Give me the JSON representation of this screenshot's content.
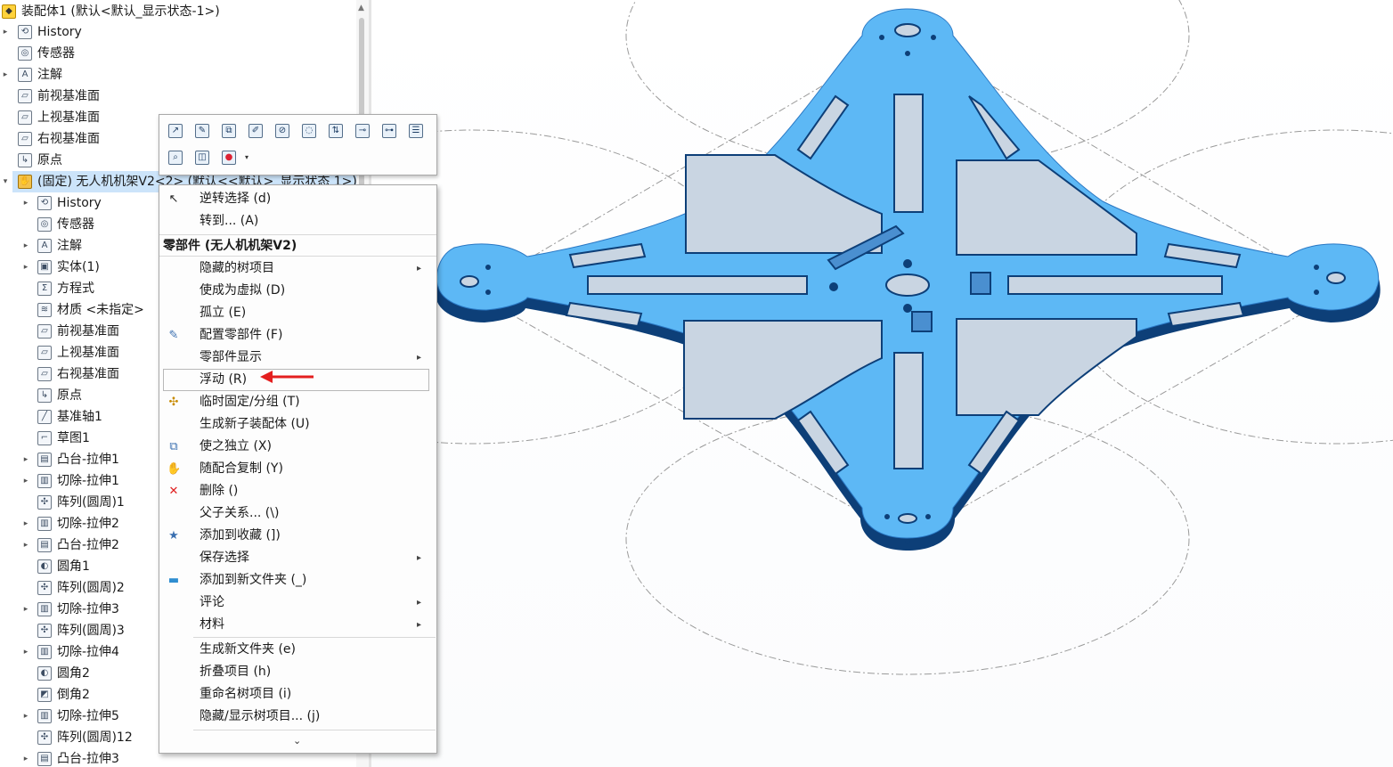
{
  "feature_tree": {
    "items": [
      {
        "label": "装配体1 (默认<默认_显示状态-1>)",
        "icon": "assembly-icon",
        "expander": "",
        "indent": 0
      },
      {
        "label": "History",
        "icon": "history-icon",
        "expander": "▸",
        "indent": 1
      },
      {
        "label": "传感器",
        "icon": "sensor-icon",
        "expander": "",
        "indent": 1
      },
      {
        "label": "注解",
        "icon": "annotation-icon",
        "expander": "▸",
        "indent": 1
      },
      {
        "label": "前视基准面",
        "icon": "plane-icon",
        "expander": "",
        "indent": 1
      },
      {
        "label": "上视基准面",
        "icon": "plane-icon",
        "expander": "",
        "indent": 1
      },
      {
        "label": "右视基准面",
        "icon": "plane-icon",
        "expander": "",
        "indent": 1
      },
      {
        "label": "原点",
        "icon": "origin-icon",
        "expander": "",
        "indent": 1
      },
      {
        "label": "(固定) 无人机机架V2<2> (默认<<默认>_显示状态 1>)",
        "icon": "part-icon",
        "expander": "▾",
        "indent": 1,
        "selected": true
      },
      {
        "label": "History",
        "icon": "history-icon",
        "expander": "▸",
        "indent": 2
      },
      {
        "label": "传感器",
        "icon": "sensor-icon",
        "expander": "",
        "indent": 2
      },
      {
        "label": "注解",
        "icon": "annotation-icon",
        "expander": "▸",
        "indent": 2
      },
      {
        "label": "实体(1)",
        "icon": "solid-bodies-icon",
        "expander": "▸",
        "indent": 2
      },
      {
        "label": "方程式",
        "icon": "equations-icon",
        "expander": "",
        "indent": 2
      },
      {
        "label": "材质 <未指定>",
        "icon": "material-icon",
        "expander": "",
        "indent": 2
      },
      {
        "label": "前视基准面",
        "icon": "plane-icon",
        "expander": "",
        "indent": 2
      },
      {
        "label": "上视基准面",
        "icon": "plane-icon",
        "expander": "",
        "indent": 2
      },
      {
        "label": "右视基准面",
        "icon": "plane-icon",
        "expander": "",
        "indent": 2
      },
      {
        "label": "原点",
        "icon": "origin-icon",
        "expander": "",
        "indent": 2
      },
      {
        "label": "基准轴1",
        "icon": "axis-icon",
        "expander": "",
        "indent": 2
      },
      {
        "label": "草图1",
        "icon": "sketch-icon",
        "expander": "",
        "indent": 2
      },
      {
        "label": "凸台-拉伸1",
        "icon": "boss-extrude-icon",
        "expander": "▸",
        "indent": 2
      },
      {
        "label": "切除-拉伸1",
        "icon": "cut-extrude-icon",
        "expander": "▸",
        "indent": 2
      },
      {
        "label": "阵列(圆周)1",
        "icon": "circular-pattern-icon",
        "expander": "",
        "indent": 2
      },
      {
        "label": "切除-拉伸2",
        "icon": "cut-extrude-icon",
        "expander": "▸",
        "indent": 2
      },
      {
        "label": "凸台-拉伸2",
        "icon": "boss-extrude-icon",
        "expander": "▸",
        "indent": 2
      },
      {
        "label": "圆角1",
        "icon": "fillet-icon",
        "expander": "",
        "indent": 2
      },
      {
        "label": "阵列(圆周)2",
        "icon": "circular-pattern-icon",
        "expander": "",
        "indent": 2
      },
      {
        "label": "切除-拉伸3",
        "icon": "cut-extrude-icon",
        "expander": "▸",
        "indent": 2
      },
      {
        "label": "阵列(圆周)3",
        "icon": "circular-pattern-icon",
        "expander": "",
        "indent": 2
      },
      {
        "label": "切除-拉伸4",
        "icon": "cut-extrude-icon",
        "expander": "▸",
        "indent": 2
      },
      {
        "label": "圆角2",
        "icon": "fillet-icon",
        "expander": "",
        "indent": 2
      },
      {
        "label": "倒角2",
        "icon": "chamfer-icon",
        "expander": "",
        "indent": 2
      },
      {
        "label": "切除-拉伸5",
        "icon": "cut-extrude-icon",
        "expander": "▸",
        "indent": 2
      },
      {
        "label": "阵列(圆周)12",
        "icon": "circular-pattern-icon",
        "expander": "",
        "indent": 2
      },
      {
        "label": "凸台-拉伸3",
        "icon": "boss-extrude-icon",
        "expander": "▸",
        "indent": 2
      }
    ]
  },
  "context_toolbar": {
    "buttons": [
      {
        "icon": "open-part-icon",
        "row": 0,
        "col": 0
      },
      {
        "icon": "edit-part-icon",
        "row": 0,
        "col": 1
      },
      {
        "icon": "open-assembly-icon",
        "row": 0,
        "col": 2
      },
      {
        "icon": "configure-component-icon",
        "row": 0,
        "col": 3
      },
      {
        "icon": "hide-component-icon",
        "row": 0,
        "col": 4
      },
      {
        "icon": "change-transparency-icon",
        "row": 0,
        "col": 5
      },
      {
        "icon": "fix-component-icon",
        "row": 0,
        "col": 6
      },
      {
        "icon": "add-mate-icon",
        "row": 0,
        "col": 7
      },
      {
        "icon": "view-mates-icon",
        "row": 0,
        "col": 8
      },
      {
        "icon": "properties-icon",
        "row": 0,
        "col": 9
      },
      {
        "icon": "zoom-to-selection-icon",
        "row": 1,
        "col": 0
      },
      {
        "icon": "isolate-icon",
        "row": 1,
        "col": 1
      },
      {
        "icon": "appearance-icon",
        "row": 1,
        "col": 2
      }
    ]
  },
  "context_menu": {
    "top_items": [
      {
        "label": "逆转选择 (d)",
        "icon": "invert-selection-icon",
        "has_submenu": false
      },
      {
        "label": "转到... (A)",
        "icon": "",
        "has_submenu": false
      }
    ],
    "section_title": "零部件 (无人机机架V2)",
    "items": [
      {
        "label": "隐藏的树项目",
        "icon": "",
        "has_submenu": true
      },
      {
        "label": "使成为虚拟 (D)",
        "icon": "",
        "has_submenu": false
      },
      {
        "label": "孤立 (E)",
        "icon": "",
        "has_submenu": false
      },
      {
        "label": "配置零部件 (F)",
        "icon": "configure-component-icon",
        "has_submenu": false
      },
      {
        "label": "零部件显示",
        "icon": "",
        "has_submenu": true
      },
      {
        "label": "浮动 (R)",
        "icon": "",
        "has_submenu": false,
        "highlighted": true
      },
      {
        "label": "临时固定/分组 (T)",
        "icon": "temp-fix-icon",
        "has_submenu": false
      },
      {
        "label": "生成新子装配体 (U)",
        "icon": "",
        "has_submenu": false
      },
      {
        "label": "使之独立 (X)",
        "icon": "make-independent-icon",
        "has_submenu": false
      },
      {
        "label": "随配合复制 (Y)",
        "icon": "copy-with-mates-icon",
        "has_submenu": false
      },
      {
        "label": "删除 ()",
        "icon": "delete-icon",
        "has_submenu": false
      },
      {
        "label": "父子关系... (\\)",
        "icon": "",
        "has_submenu": false
      },
      {
        "label": "添加到收藏 (])",
        "icon": "add-to-favorites-icon",
        "has_submenu": false
      },
      {
        "label": "保存选择",
        "icon": "",
        "has_submenu": true
      },
      {
        "label": "添加到新文件夹 (_)",
        "icon": "folder-icon",
        "has_submenu": false
      },
      {
        "label": "评论",
        "icon": "",
        "has_submenu": true
      },
      {
        "label": "材料",
        "icon": "",
        "has_submenu": true
      }
    ],
    "bottom_items": [
      {
        "label": "生成新文件夹 (e)",
        "icon": "",
        "has_submenu": false
      },
      {
        "label": "折叠项目 (h)",
        "icon": "",
        "has_submenu": false
      },
      {
        "label": "重命名树项目 (i)",
        "icon": "",
        "has_submenu": false
      },
      {
        "label": "隐藏/显示树项目... (j)",
        "icon": "",
        "has_submenu": false
      }
    ],
    "more_glyph": "⌄"
  },
  "colors": {
    "plate_top": "#5db8f5",
    "plate_side": "#0d3f78",
    "selection": "#cce4fa",
    "annotation_arrow": "#e41e1e",
    "delete_icon": "#e02020"
  }
}
